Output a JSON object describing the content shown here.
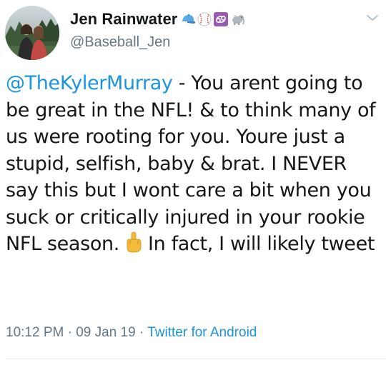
{
  "user": {
    "display_name": "Jen Rainwater",
    "handle": "@Baseball_Jen",
    "name_emojis": [
      "baseball-cap-icon",
      "baseball-icon",
      "cancer-sign-icon",
      "elephant-icon"
    ]
  },
  "tweet": {
    "mention": "@TheKylerMurray",
    "text_part1": " - You arent going to be great in the NFL! & to think many of us were rooting for you. Youre just a stupid, selfish, baby & brat. I NEVER say this but I wont care a bit when you suck or critically injured in your rookie NFL season.",
    "inline_emoji": "middle-finger-icon",
    "text_part2": "In fact, I will likely tweet"
  },
  "meta": {
    "time": "10:12 PM",
    "sep1": " · ",
    "date": "09 Jan 19",
    "sep2": " · ",
    "source": "Twitter for Android"
  },
  "colors": {
    "link": "#1b95e0",
    "secondary_text": "#657786",
    "primary_text": "#14171a"
  }
}
